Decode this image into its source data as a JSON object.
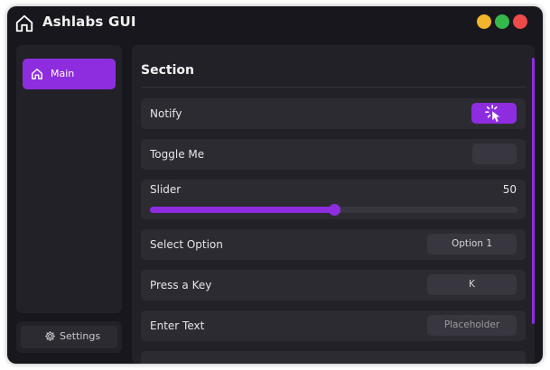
{
  "window": {
    "title": "Ashlabs GUI",
    "controls": [
      "minimize",
      "maximize",
      "close"
    ],
    "colors": {
      "minimize": "#f1b52b",
      "maximize": "#35b84b",
      "close": "#ee4a4a",
      "accent": "#8e2de0"
    }
  },
  "sidebar": {
    "items": [
      {
        "label": "Main",
        "icon": "home-icon",
        "active": true
      }
    ],
    "settings_label": "Settings"
  },
  "section": {
    "title": "Section",
    "notify_label": "Notify",
    "toggle_label": "Toggle Me",
    "toggle_on": false,
    "slider": {
      "label": "Slider",
      "value": "50",
      "min": 0,
      "max": 100,
      "fraction": 0.5
    },
    "select": {
      "label": "Select Option",
      "value": "Option 1"
    },
    "keybind": {
      "label": "Press a Key",
      "value": "K"
    },
    "text_input": {
      "label": "Enter Text",
      "placeholder": "Placeholder"
    }
  }
}
